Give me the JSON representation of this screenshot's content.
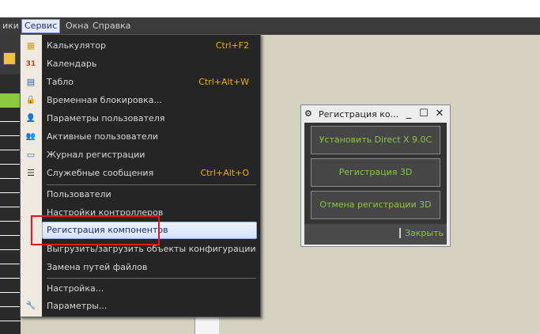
{
  "menubar": {
    "items": [
      {
        "label": "ики",
        "active": false
      },
      {
        "label": "Сервис",
        "active": true
      },
      {
        "label": "Окна",
        "active": false
      },
      {
        "label": "Справка",
        "active": false
      }
    ]
  },
  "service_menu": {
    "group1": [
      {
        "icon": "calculator-icon",
        "glyph": "▦",
        "label": "Калькулятор",
        "shortcut": "Ctrl+F2"
      },
      {
        "icon": "calendar-icon",
        "glyph": "31",
        "label": "Календарь",
        "shortcut": ""
      },
      {
        "icon": "table-icon",
        "glyph": "▤",
        "label": "Табло",
        "shortcut": "Ctrl+Alt+W"
      },
      {
        "icon": "lock-user-icon",
        "glyph": "🔒",
        "label": "Временная блокировка...",
        "shortcut": ""
      },
      {
        "icon": "user-settings-icon",
        "glyph": "👤",
        "label": "Параметры пользователя",
        "shortcut": ""
      },
      {
        "icon": "active-users-icon",
        "glyph": "👥",
        "label": "Активные пользователи",
        "shortcut": ""
      },
      {
        "icon": "log-icon",
        "glyph": "▭",
        "label": "Журнал регистрации",
        "shortcut": ""
      },
      {
        "icon": "messages-icon",
        "glyph": "☰",
        "label": "Служебные сообщения",
        "shortcut": "Ctrl+Alt+O"
      }
    ],
    "group2": [
      {
        "label": "Пользователи"
      },
      {
        "label": "Настройки контроллеров"
      },
      {
        "label": "Регистрация компонентов",
        "highlighted": true
      },
      {
        "label": "Выгрузить/загрузить объекты конфигурации"
      },
      {
        "label": "Замена путей файлов"
      }
    ],
    "group3": [
      {
        "icon": "",
        "glyph": "",
        "label": "Настройка..."
      },
      {
        "icon": "wrench-icon",
        "glyph": "🔧",
        "label": "Параметры..."
      }
    ]
  },
  "dialog": {
    "title": "Регистрация ко...",
    "buttons": [
      {
        "label": "Установить Direct X 9.0C"
      },
      {
        "label": "Регистрация 3D"
      },
      {
        "label": "Отмена регистрации 3D"
      }
    ],
    "close_label": "Закрыть",
    "title_buttons": {
      "minimize": "_",
      "maximize": "☐",
      "close": "✕"
    }
  },
  "colors": {
    "menu_bg": "#252525",
    "shortcut": "#f0b000",
    "accent_green": "#8dc63f",
    "highlight_box": "#e01818"
  }
}
